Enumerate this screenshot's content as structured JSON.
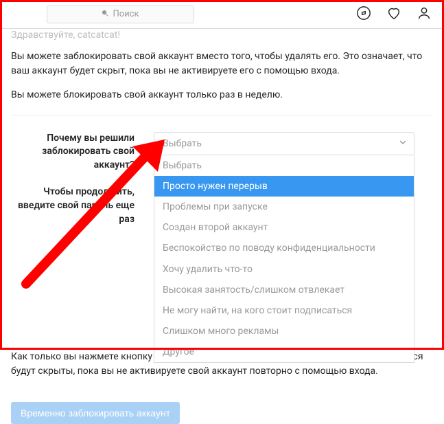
{
  "search": {
    "placeholder": "Поиск"
  },
  "cut_line": "Здравствуйте, catcatcat!",
  "para1": "Вы можете заблокировать свой аккаунт вместо того, чтобы удалять его. Это означает, что ваш аккаунт будет скрыт, пока вы не активируете его с помощью входа.",
  "para2": "Вы можете блокировать свой аккаунт только раз в неделю.",
  "form": {
    "reason_label": "Почему вы решили заблокировать свой аккаунт?",
    "password_label": "Чтобы продолжить, введите свой пароль еще раз",
    "select_placeholder": "Выбрать",
    "options": [
      "Выбрать",
      "Просто нужен перерыв",
      "Проблемы при запуске",
      "Создан второй аккаунт",
      "Беспокойство по поводу конфиденциальности",
      "Хочу удалить что-то",
      "Высокая занятость/слишком отвлекает",
      "Не могу найти, на кого стоит подписаться",
      "Слишком много рекламы",
      "Другое"
    ],
    "highlighted_index": 1
  },
  "bottom_para": "Как только вы нажмете кнопку ниже, ваши фотографии, комментарии и отметки Нравится будут скрыты, пока вы не активируете свой аккаунт повторно с помощью входа.",
  "action_button": "Временно заблокировать аккаунт"
}
